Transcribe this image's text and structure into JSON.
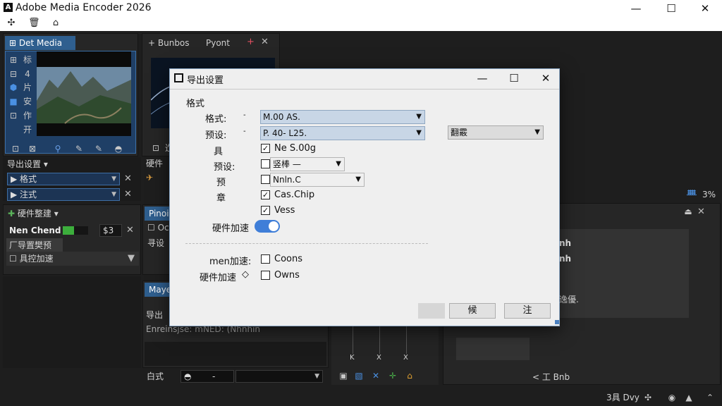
{
  "app": {
    "title": "Adobe Media Encoder 2026",
    "logo": "A"
  },
  "titlebar": {
    "icons": [
      "crosshair-icon",
      "trash-icon",
      "home-icon"
    ],
    "minimize": "—",
    "maximize": "☐",
    "close": "✕"
  },
  "media_panel": {
    "tab": "Det Media",
    "side_icons": [
      "⊞",
      "⊟",
      "●",
      "■",
      "⊞",
      ""
    ],
    "side_labels": [
      "标",
      "4",
      "片",
      "安",
      "作",
      "开"
    ],
    "bottom_icons": [
      "⊡",
      "⊠",
      "⚲",
      "✎",
      "✎",
      "◓"
    ]
  },
  "browser_panel": {
    "tabs": [
      "+ Bunbos",
      "Pyont"
    ],
    "tab_plus": "+",
    "tab_close": "✕",
    "label1": "硬件",
    "label2": "乙"
  },
  "export_settings": {
    "header": "导出设置 ▾",
    "rows": [
      {
        "label": "格式",
        "close": "✕"
      },
      {
        "label": "注式",
        "close": "✕"
      }
    ],
    "section": "硬件整建 ▾",
    "name_label": "Nen Chend",
    "name_value": "$3",
    "subsection": "厂导置樊预",
    "checkbox_label": "具控加速",
    "panel_tab": "Pinoi",
    "sub_row": "Oc",
    "sub_row2": "寻设",
    "panel_tab2": "Maye",
    "lower_label": "导出",
    "lower_text": "Enreinsjse: mNED: (Nhnhin",
    "bottom_label": "白式",
    "bottom_toggle": "◓"
  },
  "right_panel": {
    "status": "3%",
    "items": [
      "nh",
      "nh",
      "逸優."
    ],
    "footer": "< 工 Bnb",
    "status_bar": "3具 Dvy"
  },
  "timeline": {
    "icons": [
      "▣",
      "▧",
      "✕",
      "✛",
      "⌂"
    ],
    "ticks": [
      "K",
      "X",
      "X"
    ]
  },
  "dialog": {
    "title": "导出设置",
    "section_label": "格式",
    "format_label": "格式:",
    "format_value": "M.00 AS.",
    "preset_label": "预设:",
    "preset_value": "P. 40- L25.",
    "right_select": "翻霰",
    "options": [
      {
        "label": "具",
        "checked": true,
        "text": "Ne S.00g"
      },
      {
        "label": "预设:",
        "checked": false,
        "text": "竖棒 —"
      },
      {
        "label": "预",
        "checked": false,
        "text": "Nnln.C"
      },
      {
        "label": "章",
        "checked": true,
        "text": "Cas.Chip"
      },
      {
        "label": "",
        "checked": true,
        "text": "Vess"
      }
    ],
    "toggle_label": "硬件加速",
    "toggle_on": true,
    "men_label": "men加速:",
    "men_option": "Coons",
    "hw_label": "硬件加速",
    "hw_icon": "◇",
    "hw_option": "Owns",
    "buttons": [
      "",
      "候",
      "注"
    ],
    "minimize": "—",
    "maximize": "☐",
    "close": "✕"
  }
}
